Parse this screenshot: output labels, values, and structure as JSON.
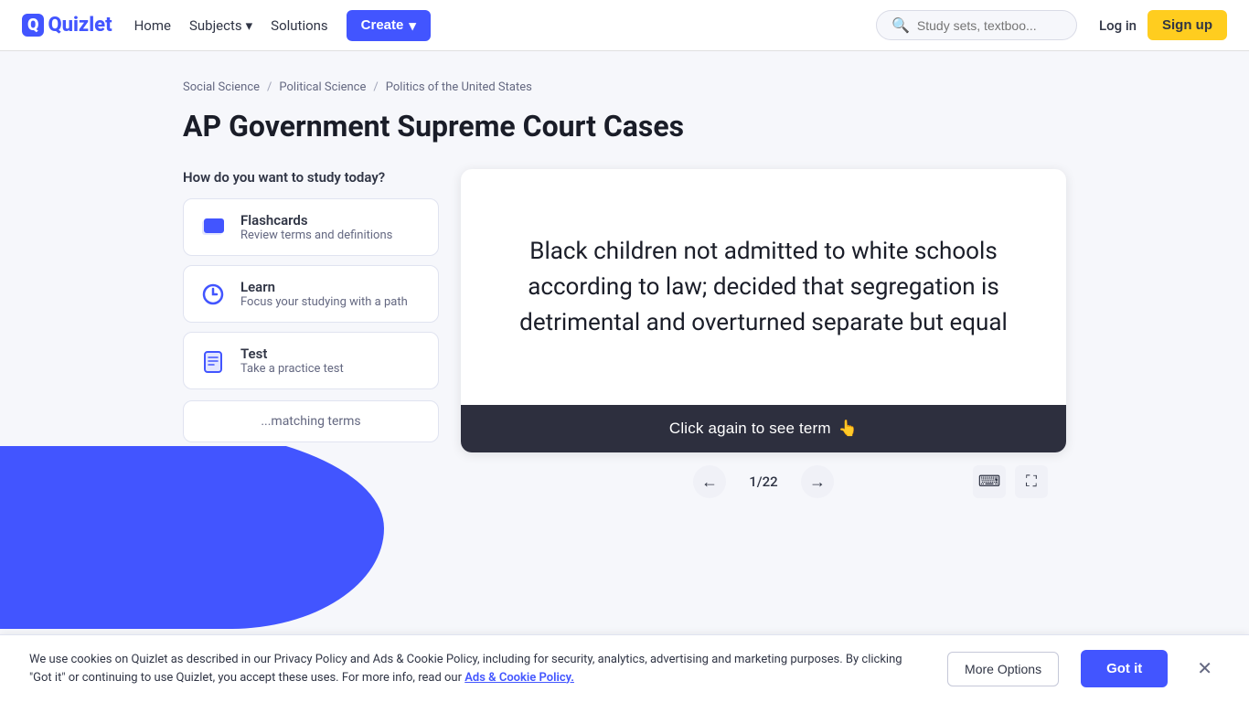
{
  "brand": {
    "logo_text": "Quizlet",
    "logo_q": "Q"
  },
  "navbar": {
    "home": "Home",
    "subjects": "Subjects",
    "subjects_icon": "▾",
    "solutions": "Solutions",
    "create": "Create",
    "create_icon": "▾",
    "search_placeholder": "Study sets, textboo...",
    "login": "Log in",
    "signup": "Sign up"
  },
  "breadcrumb": {
    "items": [
      "Social Science",
      "Political Science",
      "Politics of the United States"
    ]
  },
  "page": {
    "title": "AP Government Supreme Court Cases"
  },
  "study_panel": {
    "heading": "How do you want to study today?",
    "options": [
      {
        "name": "Flashcards",
        "desc": "Review terms and definitions",
        "icon": "flashcard"
      },
      {
        "name": "Learn",
        "desc": "Focus your studying with a path",
        "icon": "learn"
      },
      {
        "name": "Test",
        "desc": "Take a practice test",
        "icon": "test"
      }
    ],
    "more_label": "...matching terms"
  },
  "flashcard": {
    "content": "Black children not admitted to white schools according to law; decided that segregation is detrimental and overturned separate but equal",
    "click_label": "Click again to see term",
    "click_icon": "👆",
    "counter": "1/22"
  },
  "cookie": {
    "text": "We use cookies on Quizlet as described in our Privacy Policy and Ads & Cookie Policy, including for security, analytics, advertising and marketing purposes. By clicking \"Got it\" or continuing to use Quizlet, you accept these uses. For more info, read our",
    "link_text": "Ads & Cookie Policy.",
    "more_options": "More Options",
    "got_it": "Got it"
  }
}
